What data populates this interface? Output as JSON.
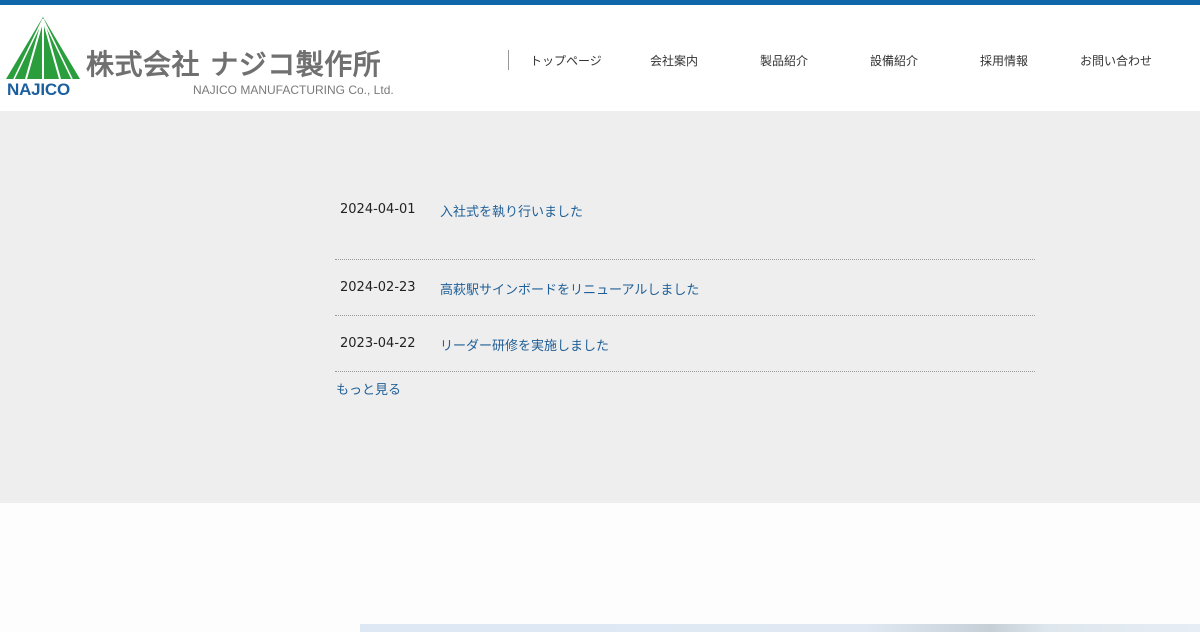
{
  "header": {
    "brand": {
      "logo_word": "NAJICO",
      "company_name": "株式会社 ナジコ製作所",
      "company_name_en": "NAJICO MANUFACTURING Co., Ltd.",
      "logo_icon": "tent-triangle-logo-icon",
      "accent_color": "#0f66a8",
      "logo_green": "#2a9d3d"
    },
    "nav": [
      {
        "label": "トップページ"
      },
      {
        "label": "会社案内"
      },
      {
        "label": "製品紹介"
      },
      {
        "label": "設備紹介"
      },
      {
        "label": "採用情報"
      },
      {
        "label": "お問い合わせ"
      }
    ]
  },
  "news": {
    "items": [
      {
        "date": "2024-04-01",
        "title": "入社式を執り行いました"
      },
      {
        "date": "2024-02-23",
        "title": "高萩駅サインボードをリニューアルしました"
      },
      {
        "date": "2023-04-22",
        "title": "リーダー研修を実施しました"
      }
    ],
    "more_label": "もっと見る",
    "link_color": "#1f5f97"
  }
}
